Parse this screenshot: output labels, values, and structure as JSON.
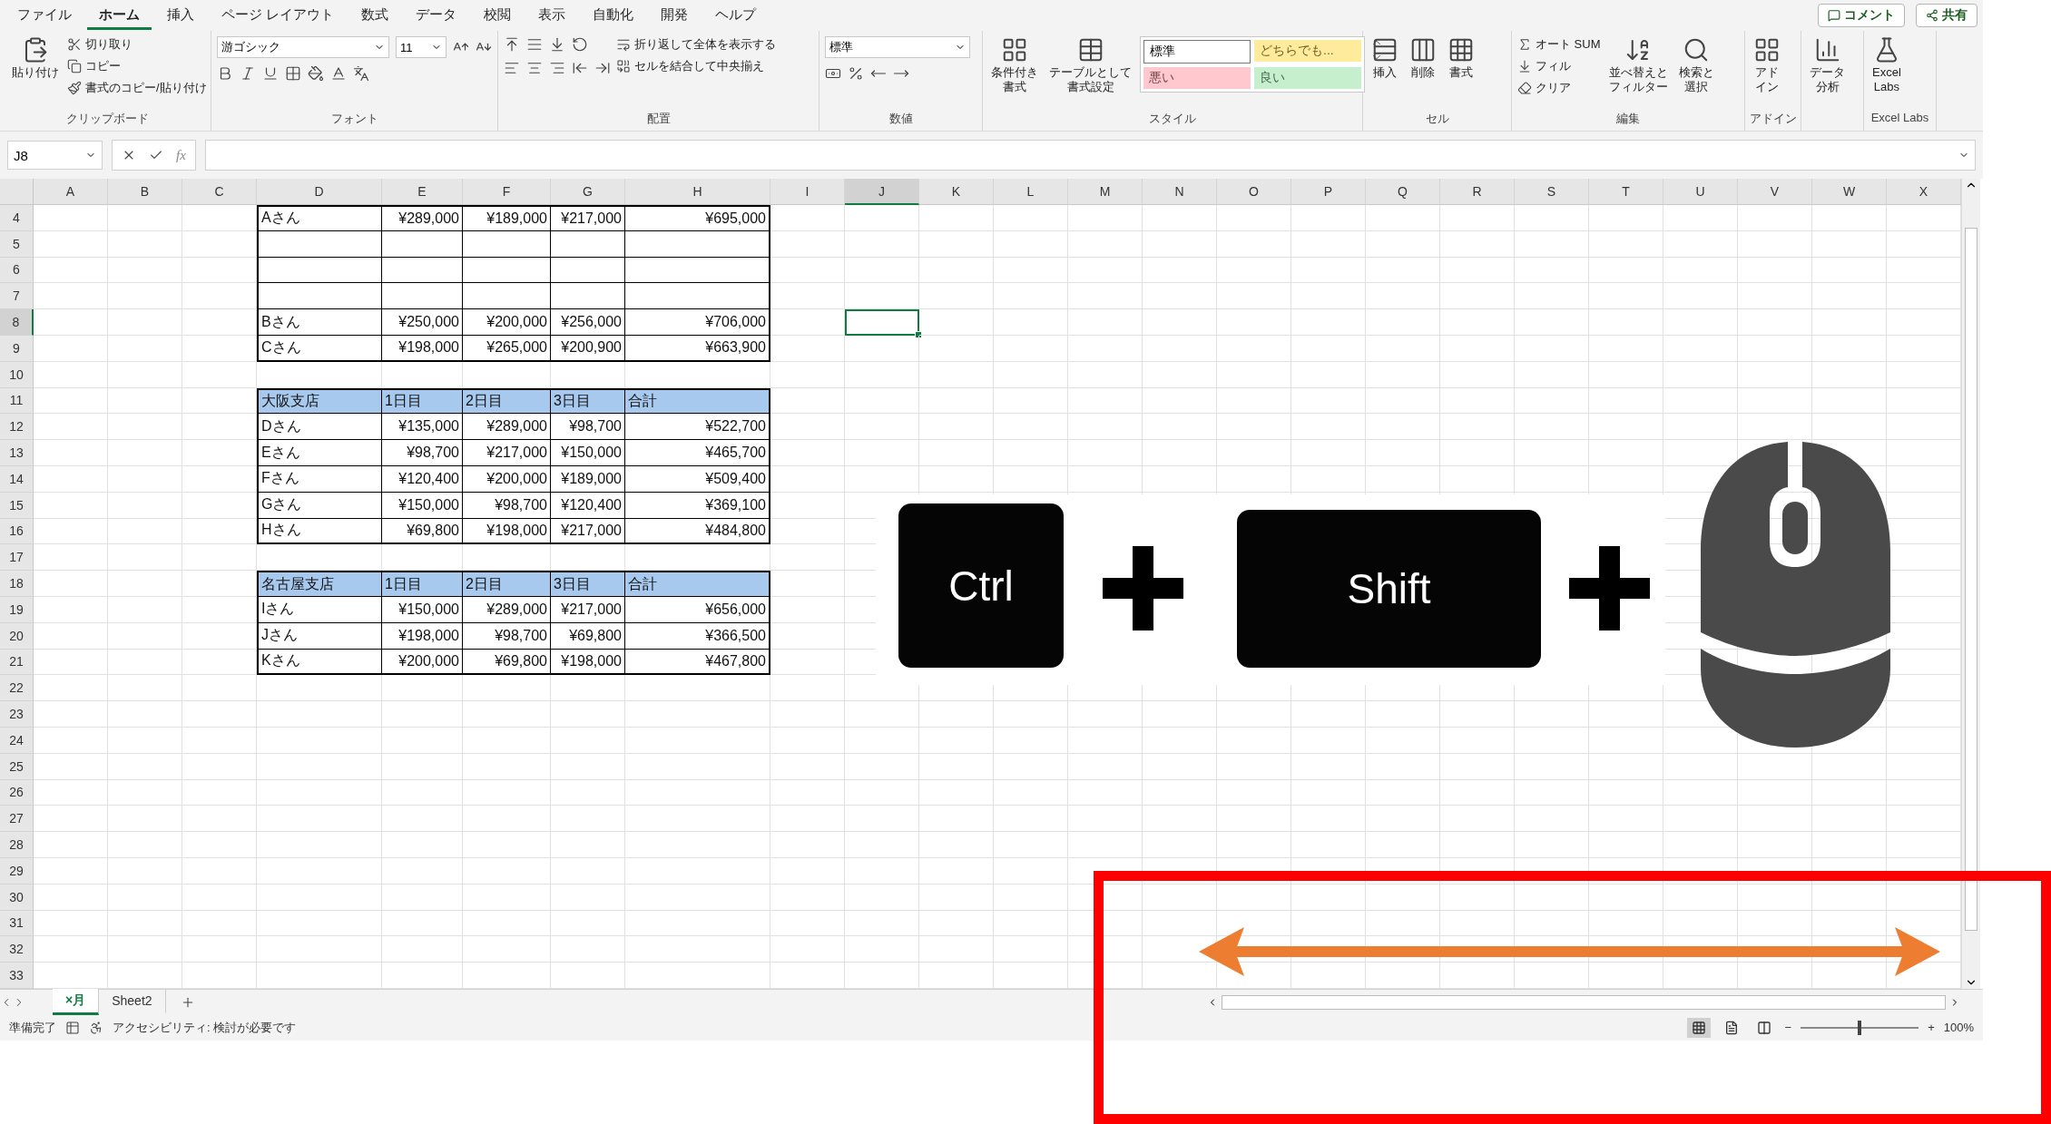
{
  "menu_tabs": [
    {
      "label": "ファイル",
      "selected": false
    },
    {
      "label": "ホーム",
      "selected": true
    },
    {
      "label": "挿入",
      "selected": false
    },
    {
      "label": "ページ レイアウト",
      "selected": false
    },
    {
      "label": "数式",
      "selected": false
    },
    {
      "label": "データ",
      "selected": false
    },
    {
      "label": "校閲",
      "selected": false
    },
    {
      "label": "表示",
      "selected": false
    },
    {
      "label": "自動化",
      "selected": false
    },
    {
      "label": "開発",
      "selected": false
    },
    {
      "label": "ヘルプ",
      "selected": false
    }
  ],
  "top_buttons": [
    "コメント",
    "共有"
  ],
  "ribbon_groups": [
    {
      "title": "クリップボード",
      "items": [
        {
          "kind": "large",
          "label": "貼り付け"
        },
        {
          "kind": "small",
          "label": "切り取り"
        },
        {
          "kind": "small",
          "label": "コピー"
        },
        {
          "kind": "small",
          "label": "書式のコピー/貼り付け"
        }
      ]
    },
    {
      "title": "フォント",
      "items": [
        {
          "kind": "select",
          "value": "游ゴシック"
        },
        {
          "kind": "select",
          "value": "11"
        }
      ]
    },
    {
      "title": "配置",
      "items": [
        {
          "kind": "small",
          "label": "折り返して全体を表示する"
        },
        {
          "kind": "small",
          "label": "セルを結合して中央揃え"
        }
      ]
    },
    {
      "title": "数値",
      "items": [
        {
          "kind": "select",
          "value": "標準"
        }
      ]
    },
    {
      "title": "スタイル",
      "items": [
        {
          "kind": "large",
          "label": [
            "条件付き",
            "書式"
          ]
        },
        {
          "kind": "large",
          "label": [
            "テーブルとして",
            "書式設定"
          ]
        }
      ],
      "styles": [
        {
          "label": "標準",
          "color": "#ffffff"
        },
        {
          "label": "どちらでも...",
          "color": "#ffeb9c"
        },
        {
          "label": "悪い",
          "color": "#ffc7ce"
        },
        {
          "label": "良い",
          "color": "#c6efce"
        }
      ]
    },
    {
      "title": "セル",
      "items": [
        {
          "kind": "large",
          "label": "挿入"
        },
        {
          "kind": "large",
          "label": "削除"
        },
        {
          "kind": "large",
          "label": "書式"
        }
      ]
    },
    {
      "title": "編集",
      "items": [
        {
          "kind": "small",
          "label": "オート SUM"
        },
        {
          "kind": "small",
          "label": "フィル"
        },
        {
          "kind": "small",
          "label": "クリア"
        },
        {
          "kind": "large",
          "label": [
            "並べ替えと",
            "フィルター"
          ]
        },
        {
          "kind": "large",
          "label": [
            "検索と",
            "選択"
          ]
        }
      ]
    },
    {
      "title": "アドイン",
      "items": [
        {
          "kind": "large",
          "label": [
            "アド",
            "イン"
          ]
        }
      ]
    },
    {
      "items": [
        {
          "kind": "large",
          "label": [
            "データ",
            "分析"
          ]
        }
      ]
    },
    {
      "title": "Excel Labs",
      "items": [
        {
          "kind": "large",
          "label": [
            "Excel",
            "Labs"
          ]
        }
      ]
    }
  ],
  "formula_bar": {
    "name_box": "J8",
    "function_label": "fx"
  },
  "columns": [
    {
      "label": "A",
      "selected": false
    },
    {
      "label": "B",
      "selected": false
    },
    {
      "label": "C",
      "selected": false
    },
    {
      "label": "D",
      "selected": false
    },
    {
      "label": "E",
      "selected": false
    },
    {
      "label": "F",
      "selected": false
    },
    {
      "label": "G",
      "selected": false
    },
    {
      "label": "H",
      "selected": false
    },
    {
      "label": "I",
      "selected": false
    },
    {
      "label": "J",
      "selected": true
    },
    {
      "label": "K",
      "selected": false
    },
    {
      "label": "L",
      "selected": false
    },
    {
      "label": "M",
      "selected": false
    },
    {
      "label": "N",
      "selected": false
    },
    {
      "label": "O",
      "selected": false
    },
    {
      "label": "P",
      "selected": false
    },
    {
      "label": "Q",
      "selected": false
    },
    {
      "label": "R",
      "selected": false
    },
    {
      "label": "S",
      "selected": false
    },
    {
      "label": "T",
      "selected": false
    },
    {
      "label": "U",
      "selected": false
    },
    {
      "label": "V",
      "selected": false
    },
    {
      "label": "W",
      "selected": false
    },
    {
      "label": "X",
      "selected": false
    }
  ],
  "rows": [
    {
      "number": "4",
      "selected": false,
      "kind": "data",
      "cells": [
        "Aさん",
        "¥289,000",
        "¥189,000",
        "¥217,000",
        "¥695,000"
      ]
    },
    {
      "number": "5",
      "selected": false,
      "kind": "blank"
    },
    {
      "number": "6",
      "selected": false,
      "kind": "blank"
    },
    {
      "number": "7",
      "selected": false,
      "kind": "blank"
    },
    {
      "number": "8",
      "selected": true,
      "kind": "data",
      "cells": [
        "Bさん",
        "¥250,000",
        "¥200,000",
        "¥256,000",
        "¥706,000"
      ]
    },
    {
      "number": "9",
      "selected": false,
      "kind": "data",
      "cells": [
        "Cさん",
        "¥198,000",
        "¥265,000",
        "¥200,900",
        "¥663,900"
      ]
    },
    {
      "number": "10",
      "selected": false,
      "kind": "empty"
    },
    {
      "number": "11",
      "selected": false,
      "kind": "header",
      "cells": [
        "大阪支店",
        "1日目",
        "2日目",
        "3日目",
        "合計"
      ]
    },
    {
      "number": "12",
      "selected": false,
      "kind": "data",
      "cells": [
        "Dさん",
        "¥135,000",
        "¥289,000",
        "¥98,700",
        "¥522,700"
      ]
    },
    {
      "number": "13",
      "selected": false,
      "kind": "data",
      "cells": [
        "Eさん",
        "¥98,700",
        "¥217,000",
        "¥150,000",
        "¥465,700"
      ]
    },
    {
      "number": "14",
      "selected": false,
      "kind": "data",
      "cells": [
        "Fさん",
        "¥120,400",
        "¥200,000",
        "¥189,000",
        "¥509,400"
      ]
    },
    {
      "number": "15",
      "selected": false,
      "kind": "data",
      "cells": [
        "Gさん",
        "¥150,000",
        "¥98,700",
        "¥120,400",
        "¥369,100"
      ]
    },
    {
      "number": "16",
      "selected": false,
      "kind": "data",
      "cells": [
        "Hさん",
        "¥69,800",
        "¥198,000",
        "¥217,000",
        "¥484,800"
      ]
    },
    {
      "number": "17",
      "selected": false,
      "kind": "empty"
    },
    {
      "number": "18",
      "selected": false,
      "kind": "header",
      "cells": [
        "名古屋支店",
        "1日目",
        "2日目",
        "3日目",
        "合計"
      ]
    },
    {
      "number": "19",
      "selected": false,
      "kind": "data",
      "cells": [
        "Iさん",
        "¥150,000",
        "¥289,000",
        "¥217,000",
        "¥656,000"
      ]
    },
    {
      "number": "20",
      "selected": false,
      "kind": "data",
      "cells": [
        "Jさん",
        "¥198,000",
        "¥98,700",
        "¥69,800",
        "¥366,500"
      ]
    },
    {
      "number": "21",
      "selected": false,
      "kind": "data",
      "cells": [
        "Kさん",
        "¥200,000",
        "¥69,800",
        "¥198,000",
        "¥467,800"
      ]
    },
    {
      "number": "22",
      "selected": false,
      "kind": "empty"
    },
    {
      "number": "23",
      "selected": false,
      "kind": "empty"
    },
    {
      "number": "24",
      "selected": false,
      "kind": "empty"
    },
    {
      "number": "25",
      "selected": false,
      "kind": "empty"
    },
    {
      "number": "26",
      "selected": false,
      "kind": "empty"
    },
    {
      "number": "27",
      "selected": false,
      "kind": "empty"
    },
    {
      "number": "28",
      "selected": false,
      "kind": "empty"
    },
    {
      "number": "29",
      "selected": false,
      "kind": "empty"
    },
    {
      "number": "30",
      "selected": false,
      "kind": "empty"
    },
    {
      "number": "31",
      "selected": false,
      "kind": "empty"
    },
    {
      "number": "32",
      "selected": false,
      "kind": "empty"
    },
    {
      "number": "33",
      "selected": false,
      "kind": "empty"
    }
  ],
  "sheet_tabs": [
    {
      "label": "×月",
      "selected": true
    },
    {
      "label": "Sheet2",
      "selected": false
    }
  ],
  "status_bar": {
    "mode": "準備完了",
    "accessibility": "アクセシビリティ: 検討が必要です",
    "view_buttons": [
      {
        "selected": true
      },
      {
        "selected": false
      },
      {
        "selected": false
      }
    ],
    "zoom_out": "−",
    "zoom_in": "+",
    "zoom": {
      "level": 0.5
    },
    "zoom_reading": "100%"
  },
  "overlay": {
    "keys": [
      "Ctrl",
      "Shift"
    ]
  }
}
